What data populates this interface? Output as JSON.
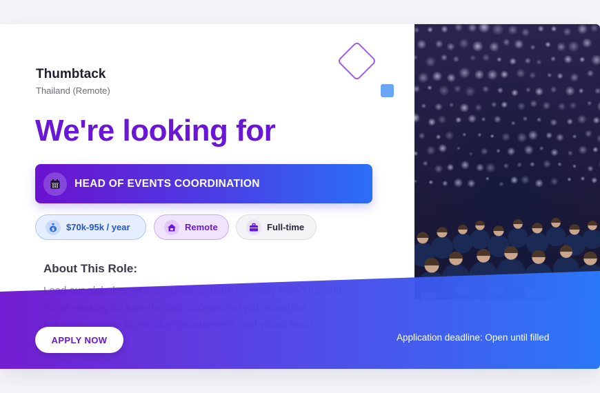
{
  "company": {
    "name": "Thumbtack",
    "location": "Thailand (Remote)"
  },
  "headline": "We're looking for",
  "role": {
    "title": "HEAD OF EVENTS COORDINATION",
    "icon": "calendar-icon"
  },
  "tags": {
    "salary": {
      "label": "$70k-95k / year",
      "icon": "money-bag-icon"
    },
    "remote": {
      "label": "Remote",
      "icon": "home-laptop-icon"
    },
    "type": {
      "label": "Full-time",
      "icon": "briefcase-icon"
    }
  },
  "about": {
    "title": "About This Role:",
    "text": "Lead our global events coordination team remotely from Thailand. We're seeking an experienced professional with expertise in international events, vendor management, and virtual team leadership."
  },
  "footer": {
    "apply_label": "APPLY NOW",
    "deadline": "Application deadline: Open until filled"
  },
  "colors": {
    "accent_purple": "#6a16d6",
    "accent_blue": "#2b6ff5",
    "diamond": "#9b5de5",
    "square": "#6aa6f5"
  }
}
